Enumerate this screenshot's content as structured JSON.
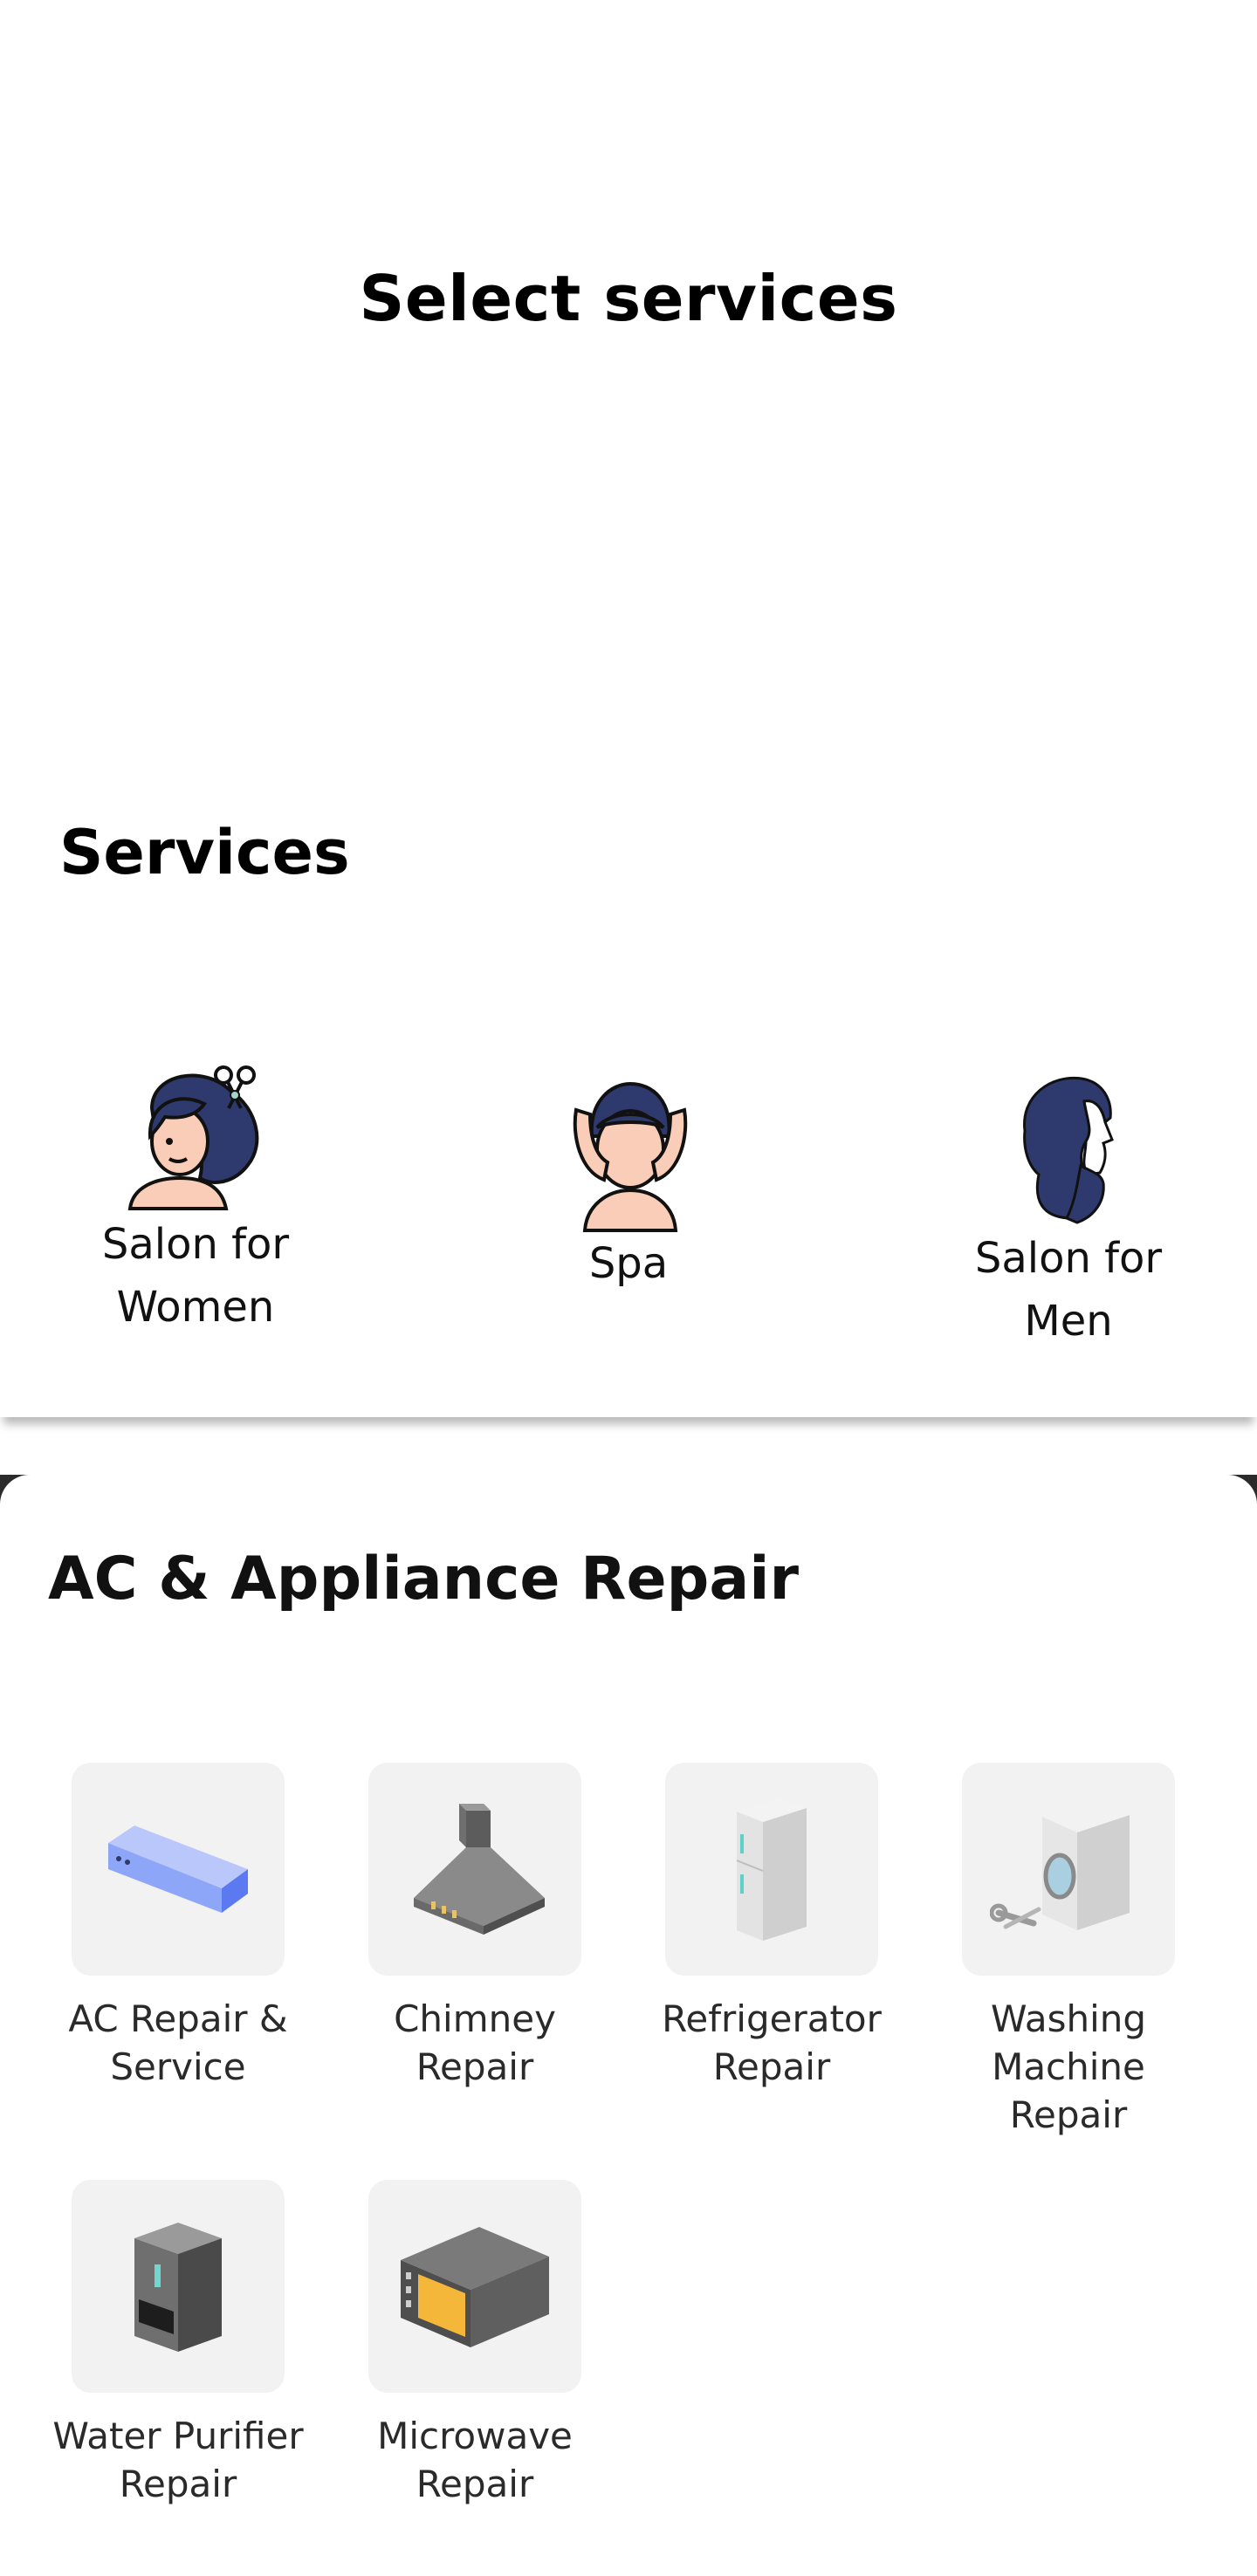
{
  "header": {
    "title": "Select services"
  },
  "services_section": {
    "heading": "Services",
    "items": [
      {
        "label": "Salon for\nWomen",
        "icon": "woman-salon-icon"
      },
      {
        "label": "Spa",
        "icon": "spa-face-icon"
      },
      {
        "label": "Salon for\nMen",
        "icon": "man-salon-icon"
      }
    ]
  },
  "repair_section": {
    "heading": "AC & Appliance Repair",
    "items": [
      {
        "label": "AC Repair &\nService",
        "icon": "air-conditioner-icon"
      },
      {
        "label": "Chimney\nRepair",
        "icon": "chimney-hood-icon"
      },
      {
        "label": "Refrigerator\nRepair",
        "icon": "refrigerator-icon"
      },
      {
        "label": "Washing\nMachine\nRepair",
        "icon": "washing-machine-icon"
      },
      {
        "label": "Water Purifier\nRepair",
        "icon": "water-purifier-icon"
      },
      {
        "label": "Microwave\nRepair",
        "icon": "microwave-icon"
      }
    ]
  },
  "colors": {
    "icon_navy": "#2e3a6e",
    "skin": "#f9cdb8",
    "tile_bg": "#f2f2f2",
    "ac_blue": "#7f9cf5"
  }
}
